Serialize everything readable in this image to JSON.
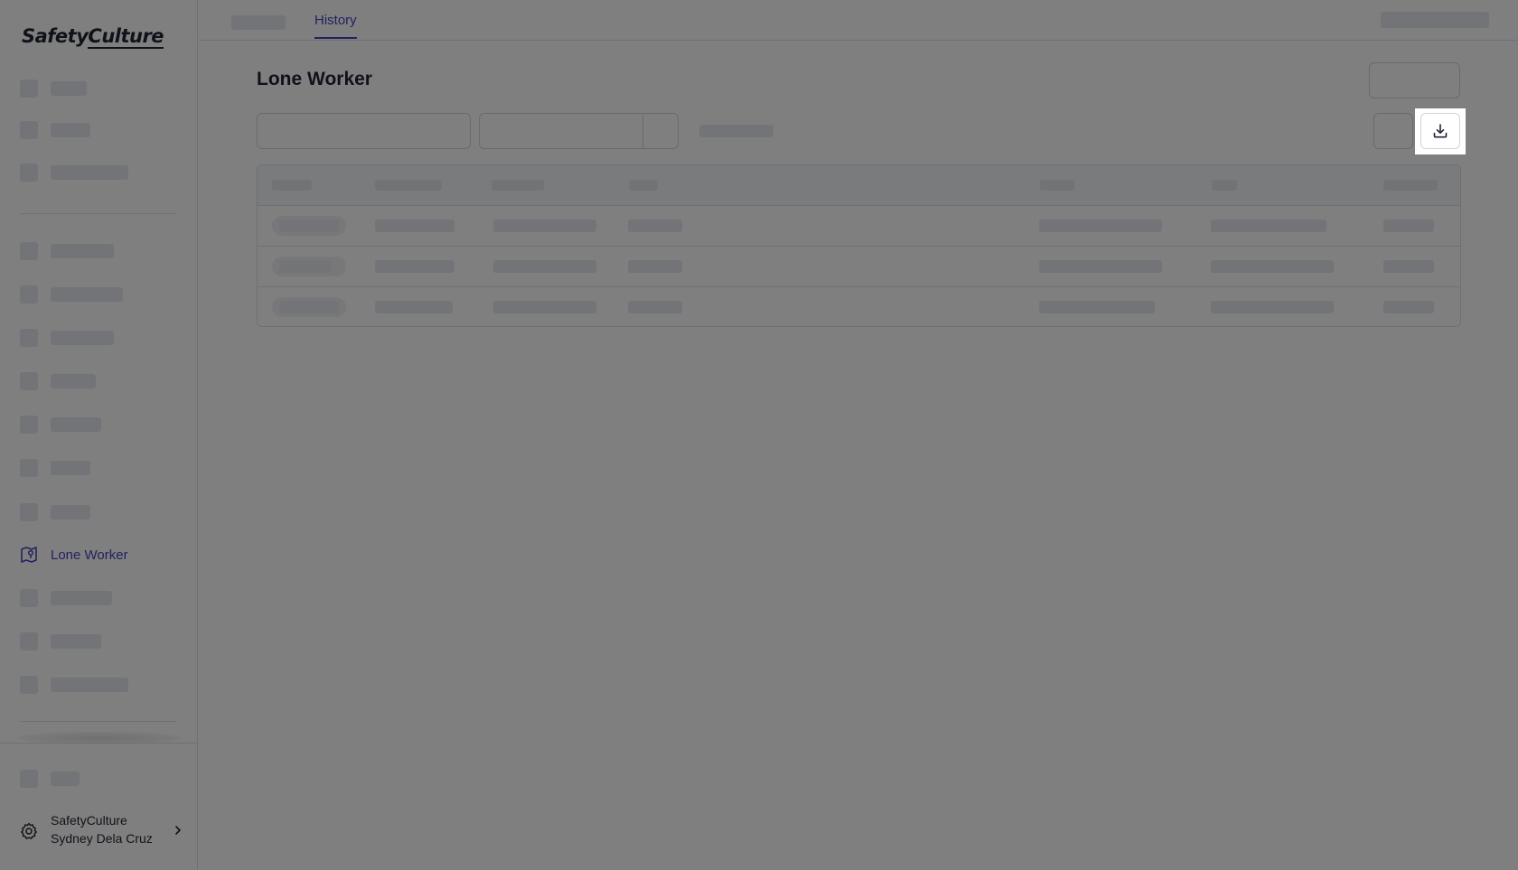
{
  "brand": {
    "logo_text_part1": "Safety",
    "logo_text_part2": "Culture"
  },
  "sidebar": {
    "active_item": {
      "label": "Lone Worker",
      "icon": "map-pin-shield-icon",
      "color": "#4743c4"
    },
    "org": {
      "name": "SafetyCulture",
      "user": "Sydney Dela Cruz",
      "icon": "gear-icon"
    }
  },
  "header": {
    "tabs": [
      {
        "label": ""
      },
      {
        "label": "History"
      }
    ],
    "active_tab": "History"
  },
  "page": {
    "title": "Lone Worker"
  },
  "toolbar": {
    "download_icon": "download-icon"
  },
  "overlay": {
    "color": "#000000",
    "opacity": 0.5
  }
}
